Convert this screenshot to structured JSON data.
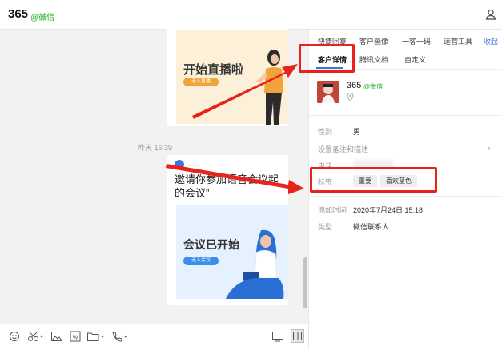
{
  "header": {
    "title": "365",
    "wechat_tag": "@微信"
  },
  "chat": {
    "card1": {
      "banner_text": "开始直播啦",
      "button_label": "进入直播"
    },
    "timestamp": "昨天 16:39",
    "card2": {
      "title": "邀请你参加语音会议起的会议”",
      "banner_text": "会议已开始",
      "button_label": "进入会议"
    }
  },
  "panel": {
    "tabs_row1": [
      "快捷回复",
      "客户画像",
      "一客一码",
      "运营工具"
    ],
    "collapse_label": "收起",
    "tabs_row2": [
      "客户详情",
      "腾讯文档",
      "自定义"
    ],
    "active_tab": "客户详情",
    "profile": {
      "name": "365",
      "wechat_tag": "@微信"
    },
    "fields": {
      "gender_label": "性别",
      "gender_value": "男",
      "remark_label": "设置备注和描述",
      "phone_label": "电话",
      "tags_label": "标签",
      "tags": [
        "重要",
        "喜欢蓝色"
      ],
      "added_time_label": "添加时间",
      "added_time_value": "2020年7月24日 15:18",
      "type_label": "类型",
      "type_value": "微信联系人"
    }
  },
  "toolbar_icons": [
    "emoji-icon",
    "scissors-icon",
    "image-icon",
    "word-doc-icon",
    "folder-icon",
    "phone-icon",
    "screen-icon",
    "sidebar-toggle-icon"
  ],
  "colors": {
    "accent": "#3b78d8",
    "wechat_green": "#1aad19",
    "annotation_red": "#e8231b"
  }
}
